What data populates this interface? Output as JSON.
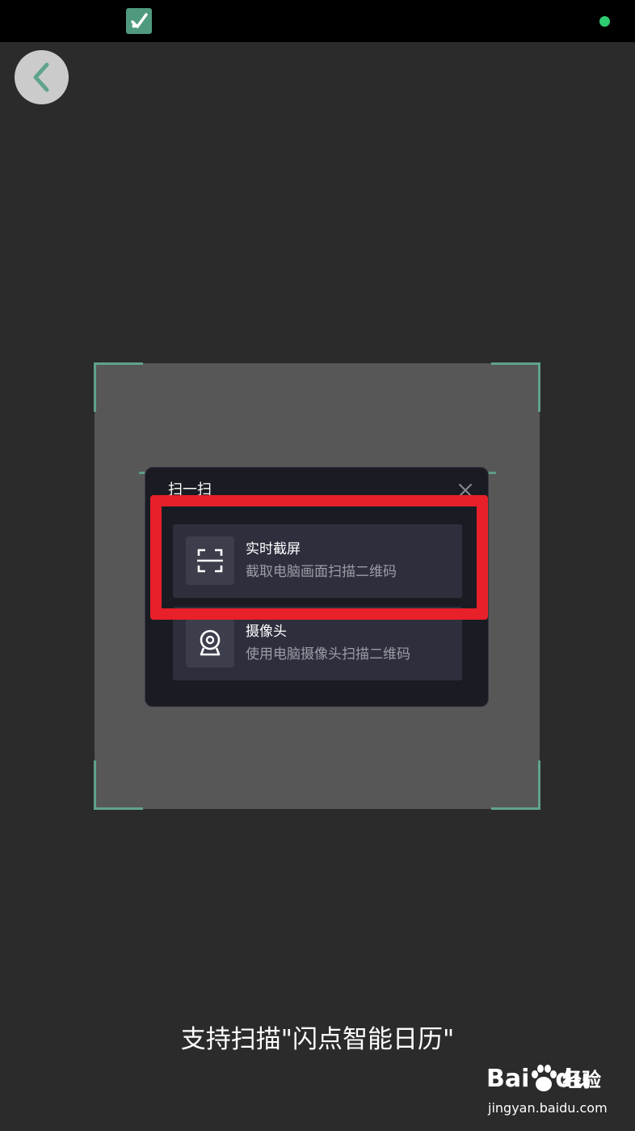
{
  "status_bar": {
    "app_icon": "check-app-icon",
    "indicator_color": "#2ecc71"
  },
  "navigation": {
    "back_icon": "chevron-left-icon"
  },
  "scanner": {
    "accent_color": "#5fa38a"
  },
  "dialog": {
    "title": "扫一扫",
    "close_icon": "close-icon",
    "options": [
      {
        "icon": "screenshot-frame-icon",
        "title": "实时截屏",
        "description": "截取电脑画面扫描二维码",
        "highlighted": true
      },
      {
        "icon": "webcam-icon",
        "title": "摄像头",
        "description": "使用电脑摄像头扫描二维码",
        "highlighted": false
      }
    ]
  },
  "highlight_color": "#e8202a",
  "caption": "支持扫描\"闪点智能日历\"",
  "watermark": {
    "logo": "Bai",
    "logo_suffix": "du",
    "brand": "经验",
    "url": "jingyan.baidu.com"
  }
}
